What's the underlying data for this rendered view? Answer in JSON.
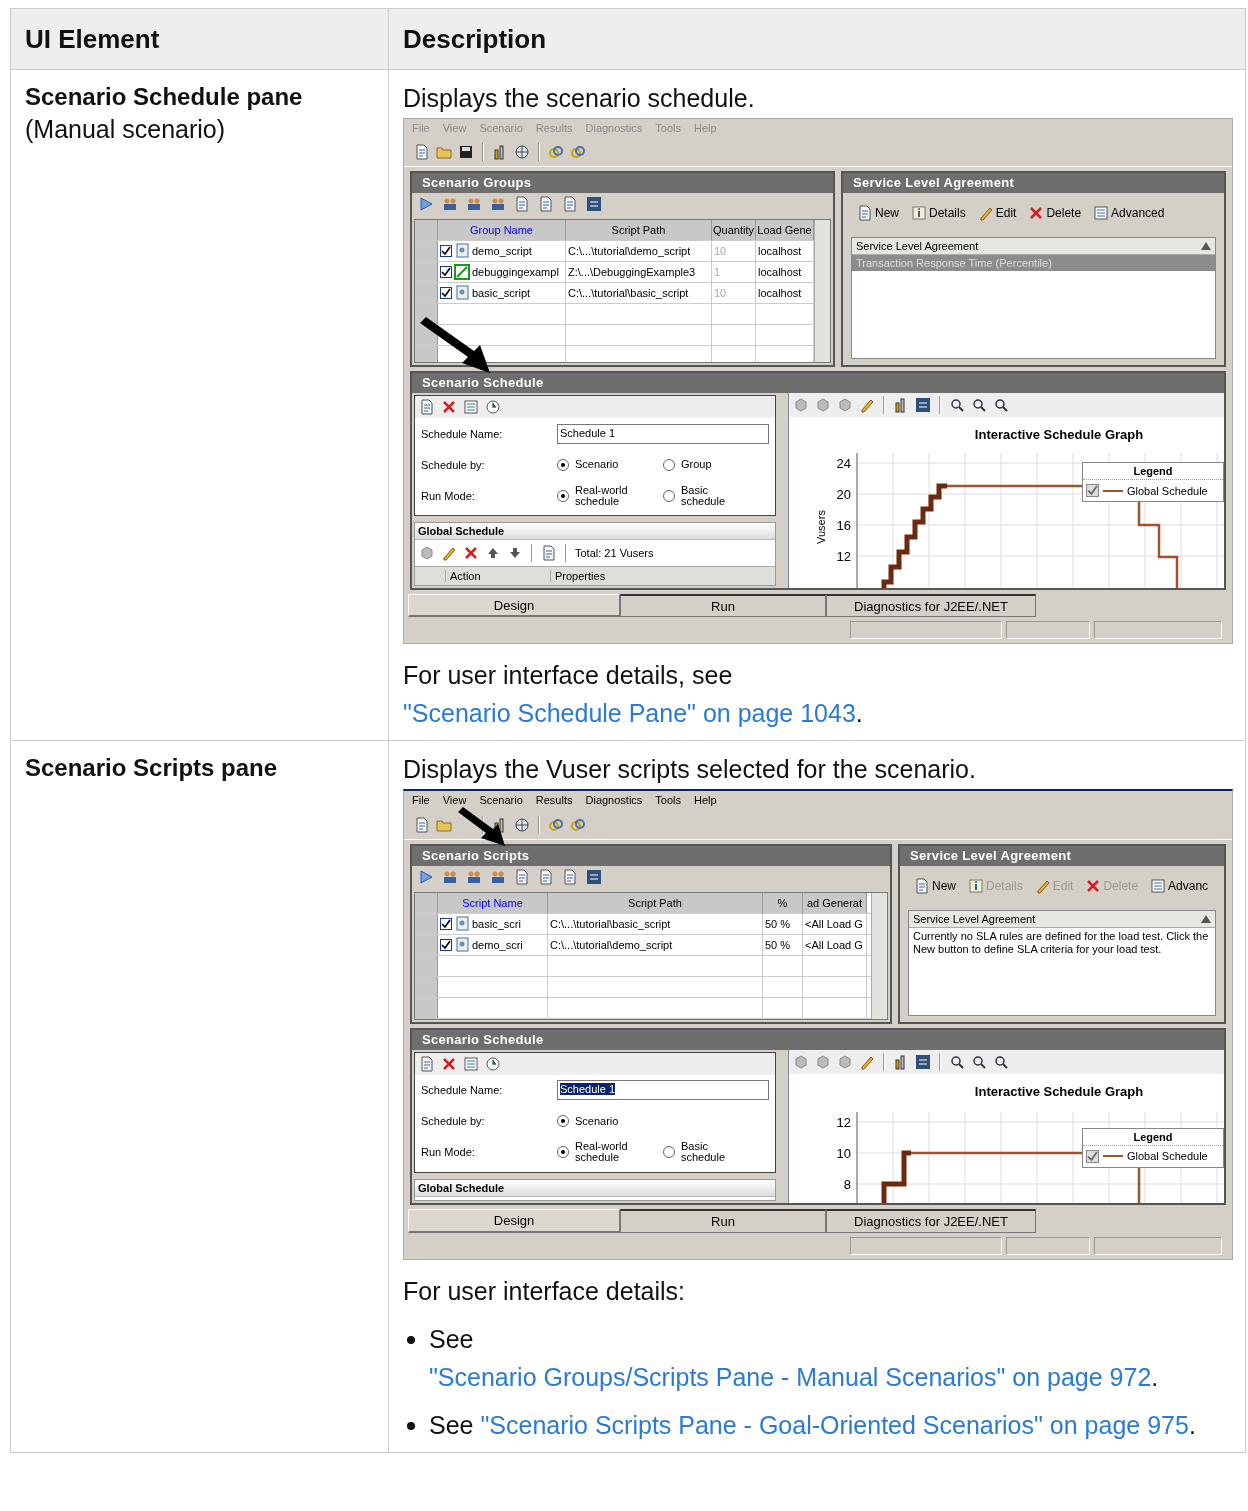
{
  "table": {
    "columns": [
      "UI Element",
      "Description"
    ],
    "rows": [
      {
        "element": "Scenario Schedule pane",
        "note": "(Manual scenario)",
        "description": {
          "intro": "Displays the scenario schedule.",
          "screenshot": {
            "menu": [
              "File",
              "View",
              "Scenario",
              "Results",
              "Diagnostics",
              "Tools",
              "Help"
            ],
            "menu_disabled": true,
            "left_pane": {
              "title": "Scenario Groups",
              "columns": [
                {
                  "label": "Group Name",
                  "sorted": true,
                  "dimmed": false
                },
                {
                  "label": "Script Path",
                  "sorted": false,
                  "dimmed": false
                },
                {
                  "label": "Quantity",
                  "sorted": false,
                  "dimmed": true
                },
                {
                  "label": "Load Gene",
                  "sorted": false,
                  "dimmed": false
                }
              ],
              "rows": [
                {
                  "checked": true,
                  "kind": "script",
                  "cells": [
                    "demo_script",
                    "C:\\...\\tutorial\\demo_script",
                    "10",
                    "localhost"
                  ]
                },
                {
                  "checked": true,
                  "kind": "flow",
                  "cells": [
                    "debuggingexampl",
                    "Z:\\...\\DebuggingExample3",
                    "1",
                    "localhost"
                  ]
                },
                {
                  "checked": true,
                  "kind": "script",
                  "cells": [
                    "basic_script",
                    "C:\\...\\tutorial\\basic_script",
                    "10",
                    "localhost"
                  ]
                }
              ]
            },
            "sla": {
              "title": "Service Level Agreement",
              "buttons": [
                {
                  "label": "New",
                  "disabled": false
                },
                {
                  "label": "Details",
                  "disabled": false
                },
                {
                  "label": "Edit",
                  "disabled": false
                },
                {
                  "label": "Delete",
                  "disabled": false
                },
                {
                  "label": "Advanced",
                  "disabled": false
                }
              ],
              "list_header": "Service Level Agreement",
              "rows": [
                {
                  "text": "Transaction Response Time (Percentile)",
                  "selected": true
                }
              ]
            },
            "schedule": {
              "title": "Scenario Schedule",
              "name_label": "Schedule Name:",
              "name_value": "Schedule 1",
              "name_selected": false,
              "fields": [
                {
                  "label": "Schedule by:",
                  "options": [
                    {
                      "label": "Scenario",
                      "selected": true
                    },
                    {
                      "label": "Group",
                      "selected": false
                    }
                  ]
                },
                {
                  "label": "Run Mode:",
                  "options": [
                    {
                      "label": "Real-world schedule",
                      "selected": true
                    },
                    {
                      "label": "Basic schedule",
                      "selected": false
                    }
                  ]
                }
              ],
              "global": {
                "title": "Global Schedule",
                "total": "Total: 21 Vusers",
                "columns": [
                  "Action",
                  "Properties"
                ]
              },
              "graph": {
                "title": "Interactive Schedule Graph",
                "ylabel": "Vusers",
                "y_ticks": [
                  "24",
                  "20",
                  "16",
                  "12"
                ],
                "legend_title": "Legend",
                "legend_item": "Global Schedule",
                "legend_checked": true
              }
            },
            "tabs": [
              {
                "label": "Design",
                "selected": true
              },
              {
                "label": "Run",
                "selected": false
              },
              {
                "label": "Diagnostics for J2EE/.NET",
                "selected": false
              }
            ]
          },
          "details": {
            "text": "For user interface details, see ",
            "link": "\"Scenario Schedule Pane\" on page 1043",
            "after": "."
          }
        }
      },
      {
        "element": "Scenario Scripts pane",
        "description": {
          "intro": "Displays the Vuser scripts selected for the scenario.",
          "screenshot": {
            "menu": [
              "File",
              "View",
              "Scenario",
              "Results",
              "Diagnostics",
              "Tools",
              "Help"
            ],
            "menu_disabled": false,
            "left_pane": {
              "title": "Scenario Scripts",
              "columns": [
                {
                  "label": "Script Name",
                  "sorted": true,
                  "dimmed": false
                },
                {
                  "label": "Script Path",
                  "sorted": false,
                  "dimmed": false
                },
                {
                  "label": "%",
                  "sorted": false,
                  "dimmed": false
                },
                {
                  "label": "ad Generat",
                  "sorted": false,
                  "dimmed": false
                }
              ],
              "rows": [
                {
                  "checked": true,
                  "kind": "script",
                  "cells": [
                    "basic_scri",
                    "C:\\...\\tutorial\\basic_script",
                    "50 %",
                    "<All Load G"
                  ]
                },
                {
                  "checked": true,
                  "kind": "script",
                  "cells": [
                    "demo_scri",
                    "C:\\...\\tutorial\\demo_script",
                    "50 %",
                    "<All Load G"
                  ]
                }
              ]
            },
            "sla": {
              "title": "Service Level Agreement",
              "buttons": [
                {
                  "label": "New",
                  "disabled": false
                },
                {
                  "label": "Details",
                  "disabled": true
                },
                {
                  "label": "Edit",
                  "disabled": true
                },
                {
                  "label": "Delete",
                  "disabled": true
                },
                {
                  "label": "Advanc",
                  "disabled": false
                }
              ],
              "list_header": "Service Level Agreement",
              "message": "Currently no SLA rules are defined for the load test. Click the New button to define SLA criteria for your load test."
            },
            "schedule": {
              "title": "Scenario Schedule",
              "name_label": "Schedule Name:",
              "name_value": "Schedule 1",
              "name_selected": true,
              "fields": [
                {
                  "label": "Schedule by:",
                  "options": [
                    {
                      "label": "Scenario",
                      "selected": true
                    }
                  ]
                },
                {
                  "label": "Run Mode:",
                  "options": [
                    {
                      "label": "Real-world schedule",
                      "selected": true
                    },
                    {
                      "label": "Basic schedule",
                      "selected": false
                    }
                  ]
                }
              ],
              "global": {
                "title": "Global Schedule"
              },
              "graph": {
                "title": "Interactive Schedule Graph",
                "y_ticks": [
                  "12",
                  "10",
                  "8"
                ],
                "legend_title": "Legend",
                "legend_item": "Global Schedule",
                "legend_checked": true
              }
            },
            "tabs": [
              {
                "label": "Design",
                "selected": true
              },
              {
                "label": "Run",
                "selected": false
              },
              {
                "label": "Diagnostics for J2EE/.NET",
                "selected": false
              }
            ]
          },
          "details": {
            "text": "For user interface details:"
          },
          "bullets": [
            {
              "text": "See ",
              "link": "\"Scenario Groups/Scripts Pane - Manual Scenarios\" on page 972",
              "after": "."
            },
            {
              "text": "See ",
              "link": "\"Scenario Scripts Pane - Goal-Oriented Scenarios\" on page 975",
              "after": "."
            }
          ]
        }
      }
    ]
  }
}
